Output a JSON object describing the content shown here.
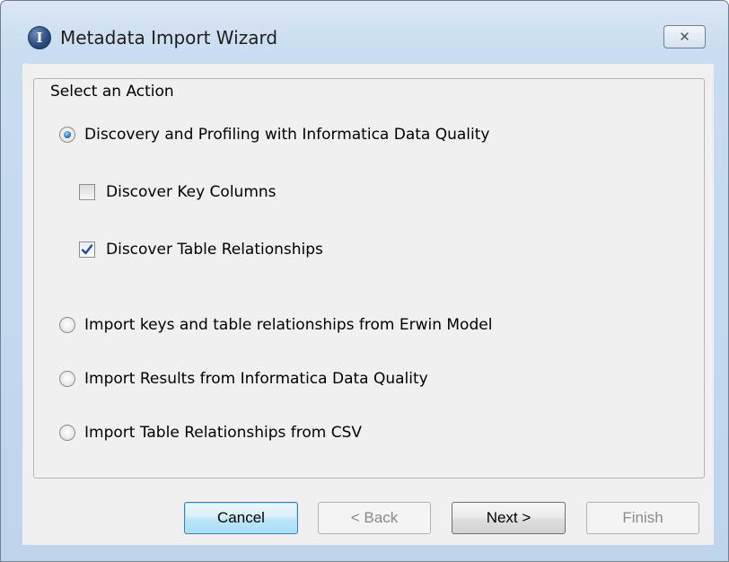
{
  "window": {
    "title": "Metadata Import Wizard",
    "icon_glyph": "I",
    "close_glyph": "✕"
  },
  "group": {
    "legend": "Select an Action"
  },
  "options": {
    "discovery": {
      "label": "Discovery and Profiling with Informatica Data Quality",
      "selected": true
    },
    "discover_keys": {
      "label": "Discover Key Columns",
      "checked": false
    },
    "discover_relationships": {
      "label": "Discover Table Relationships",
      "checked": true
    },
    "erwin": {
      "label": "Import keys and table relationships from Erwin Model",
      "selected": false
    },
    "import_idq": {
      "label": "Import Results from Informatica Data Quality",
      "selected": false
    },
    "csv": {
      "label": "Import Table Relationships from CSV",
      "selected": false
    }
  },
  "buttons": {
    "cancel": "Cancel",
    "back": "< Back",
    "next": "Next >",
    "finish": "Finish"
  },
  "colors": {
    "accent": "#2b77c4",
    "title_bar": "#c9dcf0",
    "client_bg": "#f0f0f0"
  }
}
